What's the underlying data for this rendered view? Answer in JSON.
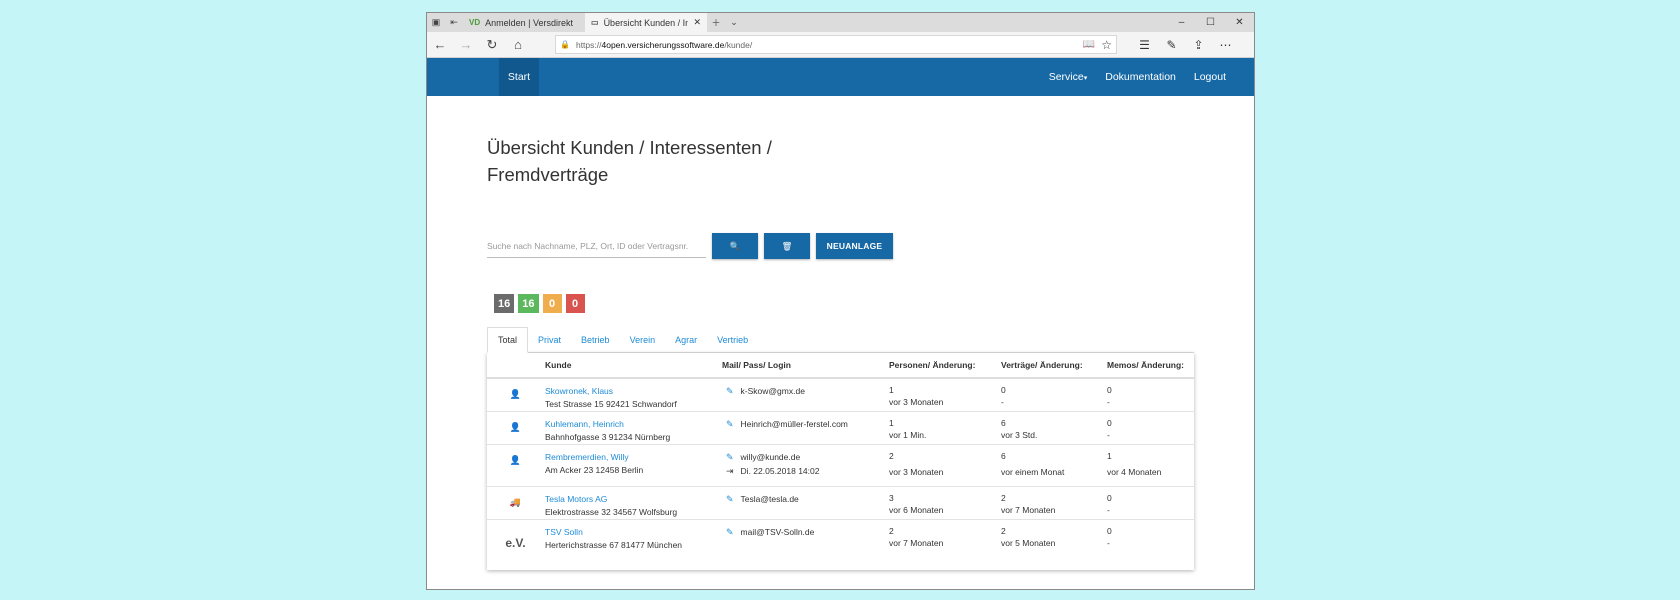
{
  "browser": {
    "tabs": [
      {
        "favicon": "VD",
        "label": "Anmelden | Versdirekt",
        "active": false
      },
      {
        "favicon": "page-icon",
        "label": "Übersicht Kunden / Inte",
        "active": true
      }
    ],
    "url": {
      "scheme": "https://",
      "host": "4open.versicherungssoftware.de",
      "path": "/kunde/"
    }
  },
  "site_nav": {
    "start": "Start",
    "service": "Service",
    "docs": "Dokumentation",
    "logout": "Logout"
  },
  "page": {
    "title": "Übersicht Kunden / Interessenten / Fremdverträge",
    "search_placeholder": "Suche nach Nachname, PLZ, Ort, ID oder Vertragsnr.",
    "new_button": "NEUANLAGE"
  },
  "badges": [
    {
      "value": "16",
      "color": "#6b6b6b"
    },
    {
      "value": "16",
      "color": "#5cb85c"
    },
    {
      "value": "0",
      "color": "#f0ad4e"
    },
    {
      "value": "0",
      "color": "#d9534f"
    }
  ],
  "content_tabs": [
    "Total",
    "Privat",
    "Betrieb",
    "Verein",
    "Agrar",
    "Vertrieb"
  ],
  "table": {
    "headers": [
      "Kunde",
      "Mail/ Pass/ Login",
      "Personen/ Änderung:",
      "Verträge/ Änderung:",
      "Memos/ Änderung:"
    ],
    "rows": [
      {
        "icon": "person-icon",
        "name": "Skowronek, Klaus",
        "address": "Test Strasse 15 92421 Schwandorf",
        "mail": "k-Skow@gmx.de",
        "login": "",
        "persons": "1",
        "persons_change": "vor 3 Monaten",
        "contracts": "0",
        "contracts_change": "-",
        "memos": "0",
        "memos_change": "-"
      },
      {
        "icon": "person-icon",
        "name": "Kuhlemann, Heinrich",
        "address": "Bahnhofgasse 3 91234 Nürnberg",
        "mail": "Heinrich@müller-ferstel.com",
        "login": "",
        "persons": "1",
        "persons_change": "vor 1 Min.",
        "contracts": "6",
        "contracts_change": "vor 3 Std.",
        "memos": "0",
        "memos_change": "-"
      },
      {
        "icon": "person-icon",
        "name": "Rembremerdien, Willy",
        "address": "Am Acker 23 12458 Berlin",
        "mail": "willy@kunde.de",
        "login": "Di. 22.05.2018 14:02",
        "persons": "2",
        "persons_change": "vor 3 Monaten",
        "contracts": "6",
        "contracts_change": "vor einem Monat",
        "memos": "1",
        "memos_change": "vor 4 Monaten"
      },
      {
        "icon": "truck-icon",
        "name": "Tesla Motors AG",
        "address": "Elektrostrasse 32 34567 Wolfsburg",
        "mail": "Tesla@tesla.de",
        "login": "",
        "persons": "3",
        "persons_change": "vor 6 Monaten",
        "contracts": "2",
        "contracts_change": "vor 7 Monaten",
        "memos": "0",
        "memos_change": "-"
      },
      {
        "icon": "ev-icon",
        "icon_text": "e.V.",
        "name": "TSV Solln",
        "address": "Herterichstrasse 67 81477 München",
        "mail": "mail@TSV-Solln.de",
        "login": "",
        "persons": "2",
        "persons_change": "vor 7 Monaten",
        "contracts": "2",
        "contracts_change": "vor 5 Monaten",
        "memos": "0",
        "memos_change": "-"
      }
    ]
  }
}
